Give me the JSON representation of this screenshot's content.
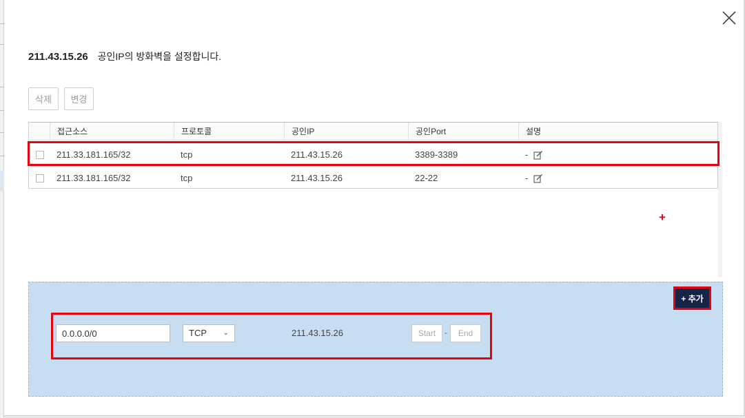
{
  "header": {
    "ip": "211.43.15.26",
    "description": "공인IP의 방화벽을 설정합니다."
  },
  "toolbar": {
    "delete_label": "삭제",
    "change_label": "변경"
  },
  "table": {
    "columns": [
      "접근소스",
      "프로토콜",
      "공인IP",
      "공인Port",
      "설명"
    ],
    "rows": [
      {
        "source": "211.33.181.165/32",
        "protocol": "tcp",
        "public_ip": "211.43.15.26",
        "port": "3389-3389",
        "desc": "-"
      },
      {
        "source": "211.33.181.165/32",
        "protocol": "tcp",
        "public_ip": "211.43.15.26",
        "port": "22-22",
        "desc": "-"
      }
    ]
  },
  "add_form": {
    "add_button_label": "+ 추가",
    "source_value": "0.0.0.0/0",
    "protocol_value": "TCP",
    "public_ip": "211.43.15.26",
    "port_start_placeholder": "Start",
    "port_end_placeholder": "End",
    "port_separator": "-"
  },
  "marker": {
    "plus": "+"
  },
  "icons": {
    "close": "close-icon",
    "edit": "edit-icon",
    "chevron": "chevron-down-icon"
  },
  "colors": {
    "highlight_red": "#e60012",
    "add_panel_bg": "#c7ddf2",
    "add_button_bg": "#162447"
  }
}
